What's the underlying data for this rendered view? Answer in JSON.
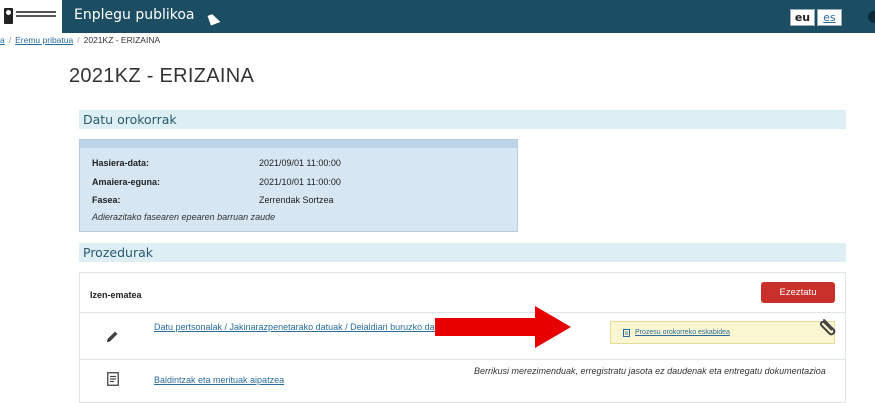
{
  "header": {
    "app_title": "Enplegu publikoa",
    "languages": {
      "eu": "eu",
      "es": "es"
    }
  },
  "breadcrumb": {
    "items": [
      "a",
      "Eremu pribatua"
    ],
    "separator": "/",
    "current": "2021KZ - ERIZAINA"
  },
  "page": {
    "title": "2021KZ - ERIZAINA"
  },
  "general": {
    "heading": "Datu orokorrak",
    "rows": [
      {
        "label": "Hasiera-data:",
        "value": "2021/09/01 11:00:00"
      },
      {
        "label": "Amaiera-eguna:",
        "value": "2021/10/01 11:00:00"
      },
      {
        "label": "Fasea:",
        "value": "Zerrendak Sortzea"
      }
    ],
    "note": "Adierazitako fasearen epearen barruan zaude"
  },
  "procedures": {
    "heading": "Prozedurak",
    "title": "Izen-ematea",
    "reject_label": "Ezeztatu",
    "rows": [
      {
        "icon": "pencil-icon",
        "link": "Datu pertsonalak / Jakinarazpenetarako datuak / Deialdiari buruzko datuak",
        "request_label": "Prozesu orokorreko eskabidea"
      },
      {
        "icon": "document-icon",
        "link": "Baldintzak eta merituak aipatzea",
        "note": "Berrikusi merezimenduak, erregistratu jasota ez daudenak eta entregatu dokumentazioa"
      }
    ]
  },
  "colors": {
    "topbar": "#1c4e63",
    "section_bg": "#ddeef4",
    "info_bg": "#d6e6f2",
    "reject": "#c9302c",
    "arrow": "#e60000",
    "request_bg": "#fbf6d2",
    "link": "#2a6c9a"
  }
}
